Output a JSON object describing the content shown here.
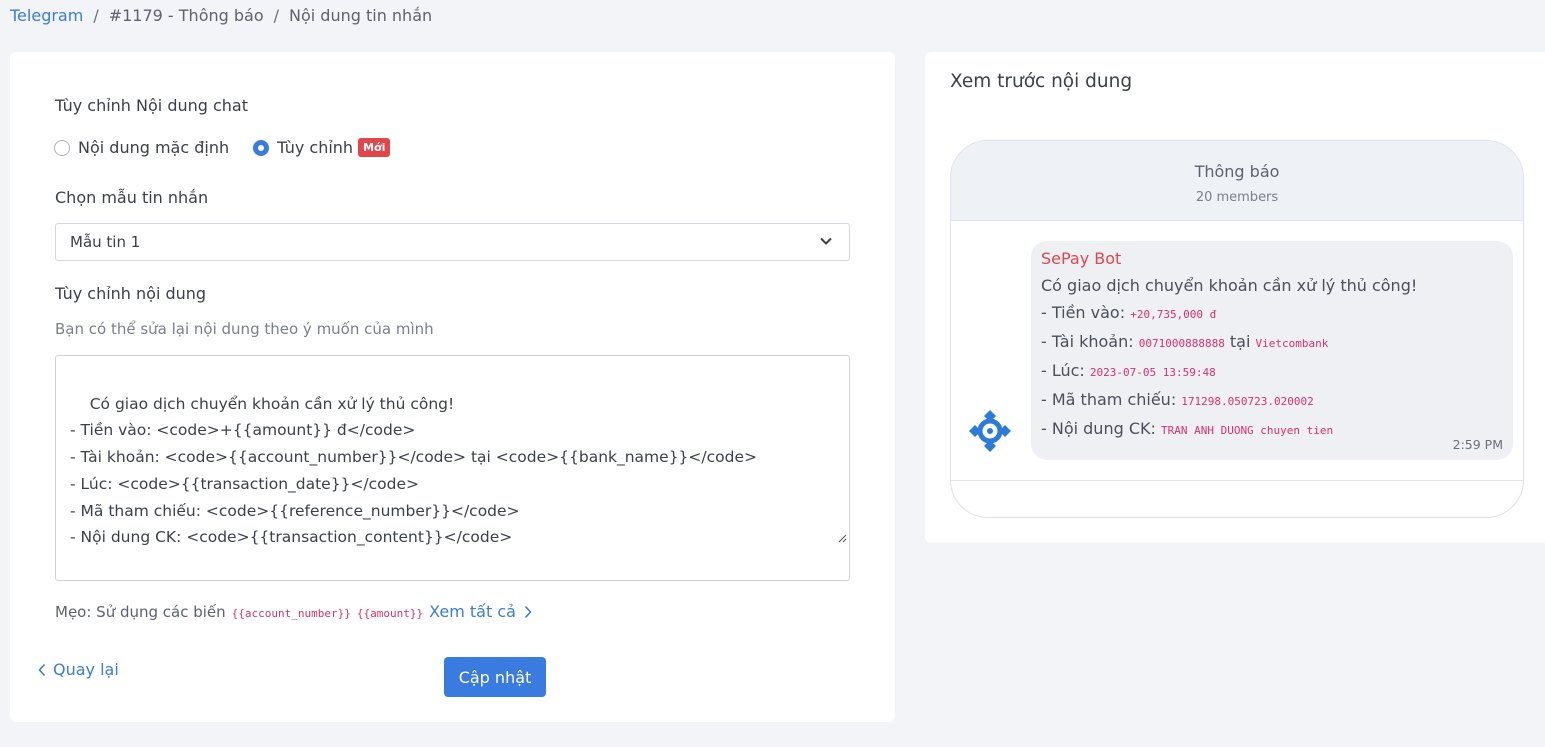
{
  "breadcrumb": {
    "root": "Telegram",
    "item": "#1179 - Thông báo",
    "current": "Nội dung tin nhắn",
    "separator": "/"
  },
  "form": {
    "custom_chat_title": "Tùy chỉnh Nội dung chat",
    "radio_default": "Nội dung mặc định",
    "radio_custom": "Tùy chỉnh",
    "badge_new": "Mới",
    "template_label": "Chọn mẫu tin nhắn",
    "template_selected": "Mẫu tin 1",
    "content_label": "Tùy chỉnh nội dung",
    "content_hint": "Bạn có thể sửa lại nội dung theo ý muốn của mình",
    "content_value": "Có giao dịch chuyển khoản cần xử lý thủ công!\n- Tiền vào: <code>+{{amount}} đ</code>\n- Tài khoản: <code>{{account_number}}</code> tại <code>{{bank_name}}</code>\n- Lúc: <code>{{transaction_date}}</code>\n- Mã tham chiếu: <code>{{reference_number}}</code>\n- Nội dung CK: <code>{{transaction_content}}</code>",
    "tip_label": "Mẹo: Sử dụng các biến",
    "tip_var1": "{{account_number}}",
    "tip_var2": "{{amount}}",
    "see_all": "Xem tất cả",
    "back": "Quay lại",
    "update": "Cập nhật"
  },
  "preview": {
    "title": "Xem trước nội dung",
    "chat_name": "Thông báo",
    "members": "20 members",
    "sender": "SePay Bot",
    "line1": "Có giao dịch chuyển khoản cần xử lý thủ công!",
    "amount_label": "- Tiền vào: ",
    "amount_value": "+20,735,000 đ",
    "account_label": "- Tài khoản: ",
    "account_value": "0071000888888",
    "at": " tại ",
    "bank_value": "Vietcombank",
    "time_label": "- Lúc: ",
    "time_value": "2023-07-05 13:59:48",
    "ref_label": "- Mã tham chiếu: ",
    "ref_value": "171298.050723.020002",
    "content_label": "- Nội dung CK: ",
    "content_value": "TRAN ANH DUONG chuyen tien",
    "timestamp": "2:59 PM"
  },
  "colors": {
    "accent": "#3a7be0",
    "badge": "#e0464c",
    "code": "#d6336c",
    "sender": "#e0464c"
  },
  "icons": {
    "select": "chevron-down-icon",
    "see_all": "chevron-right-icon",
    "back": "chevron-left-icon",
    "avatar": "sepay-logo-icon",
    "resize": "resize-handle-icon"
  }
}
